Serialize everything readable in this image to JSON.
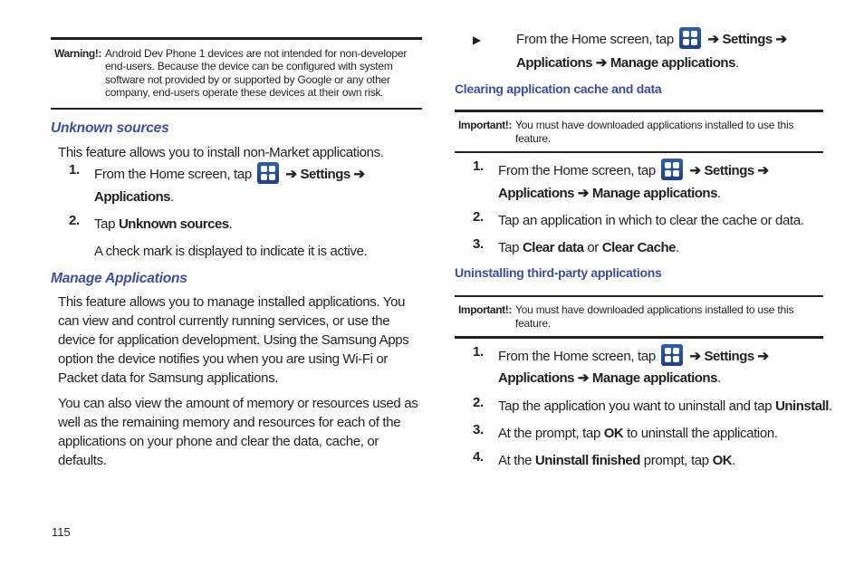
{
  "left": {
    "warning": {
      "label": "Warning!:",
      "text": "Android Dev Phone 1 devices are not intended for non-developer end-users. Because the device can be configured with system software not provided by or supported by Google or any other company, end-users operate these devices at their own risk."
    },
    "unknown_sources": {
      "heading": "Unknown sources",
      "intro": "This feature allows you to install non-Market applications.",
      "steps": [
        {
          "num": "1.",
          "pre": "From the Home screen, tap",
          "icon": "applications-icon",
          "arrow1": "➔",
          "settings": "Settings",
          "arrow2": "➔",
          "applications": "Applications",
          "end": "."
        },
        {
          "num": "2.",
          "pre": "Tap ",
          "bold": "Unknown sources",
          "end": "."
        }
      ],
      "note": "A check mark is displayed to indicate it is active."
    },
    "manage_applications": {
      "heading": "Manage Applications",
      "para1": "This feature allows you to manage installed applications. You can view and control currently running services, or use the device for application development. Using the Samsung Apps option the device notifies you when you are using Wi-Fi or Packet data for Samsung applications.",
      "para2": "You can also view the amount of memory or resources used as well as the remaining memory and resources for each of the applications on your phone and clear the data, cache, or defaults."
    }
  },
  "right": {
    "bullet_step": {
      "bullet": "▶",
      "pre": "From the Home screen, tap",
      "arrow1": "➔",
      "settings": "Settings",
      "arrow2": "➔",
      "applications": "Applications",
      "arrow3": "➔",
      "manage": "Manage applications",
      "end": "."
    },
    "clearing": {
      "heading": "Clearing application cache and data",
      "important_label": "Important!:",
      "important_text": "You must have downloaded applications installed to use this feature.",
      "steps": [
        {
          "num": "1.",
          "pre": "From the Home screen, tap",
          "arrow1": "➔",
          "settings": "Settings",
          "arrow2": "➔",
          "applications": "Applications",
          "arrow3": "➔",
          "manage": "Manage applications",
          "end": "."
        },
        {
          "num": "2.",
          "text": "Tap an application in which to clear the cache or data."
        },
        {
          "num": "3.",
          "pre": "Tap ",
          "bold1": "Clear data",
          "mid": " or ",
          "bold2": "Clear Cache",
          "end": "."
        }
      ]
    },
    "uninstalling": {
      "heading": "Uninstalling third-party applications",
      "important_label": "Important!:",
      "important_text": "You must have downloaded applications installed to use this feature.",
      "steps": [
        {
          "num": "1.",
          "pre": "From the Home screen, tap",
          "arrow1": "➔",
          "settings": "Settings",
          "arrow2": "➔",
          "applications": "Applications",
          "arrow3": "➔",
          "manage": "Manage applications",
          "end": "."
        },
        {
          "num": "2.",
          "pre": "Tap the application you want to uninstall and tap ",
          "bold": "Uninstall",
          "end": "."
        },
        {
          "num": "3.",
          "pre": "At the prompt, tap ",
          "bold": "OK",
          "post": " to uninstall the application."
        },
        {
          "num": "4.",
          "pre": "At the ",
          "bold1": "Uninstall finished",
          "mid": " prompt, tap ",
          "bold2": "OK",
          "end": "."
        }
      ]
    }
  },
  "page_number": "115",
  "colors": {
    "heading": "#3a4fa3",
    "text": "#231f20",
    "icon": "#2e5faa"
  }
}
